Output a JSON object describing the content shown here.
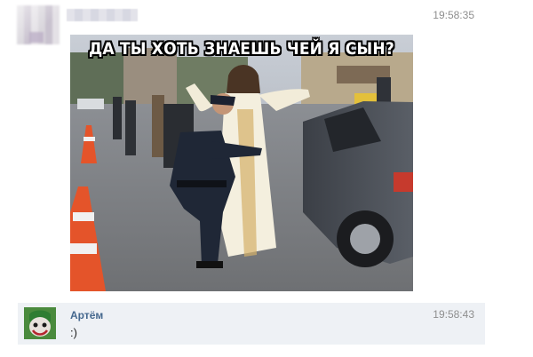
{
  "messages": [
    {
      "time": "19:58:35",
      "photo": {
        "caption": "ДА ТЫ ХОТЬ ЗНАЕШЬ ЧЕЙ Я СЫН?"
      }
    },
    {
      "sender": "Артём",
      "time": "19:58:43",
      "text": ":)"
    }
  ]
}
